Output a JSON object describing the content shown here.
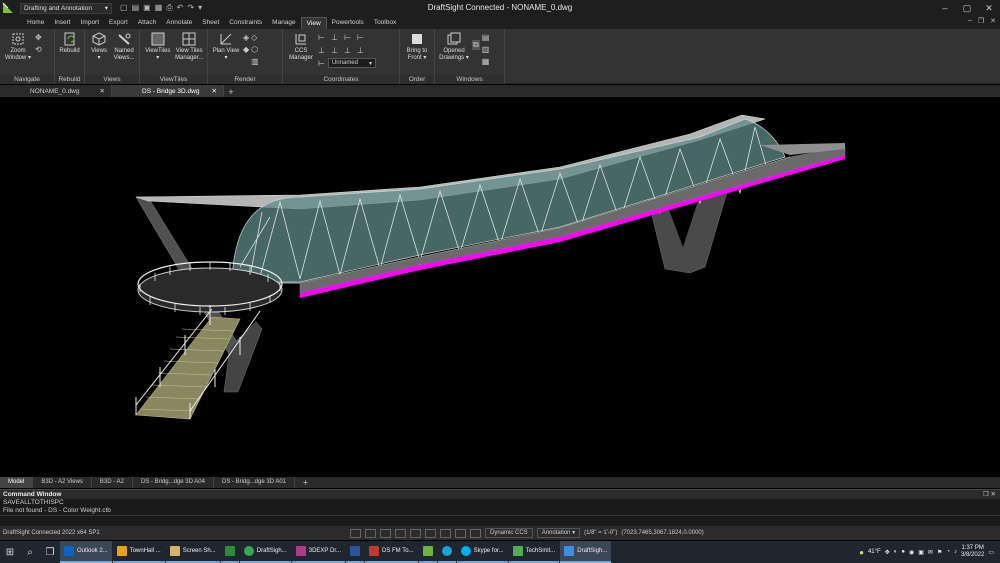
{
  "titlebar": {
    "workspace": "Drafting and Annotation",
    "title": "DraftSight Connected - NONAME_0.dwg"
  },
  "ribbon_tabs": [
    "Home",
    "Insert",
    "Import",
    "Export",
    "Attach",
    "Annotate",
    "Sheet",
    "Constraints",
    "Manage",
    "View",
    "Powertools",
    "Toolbox"
  ],
  "active_tab": "View",
  "ribbon": {
    "navigate": {
      "label": "Navigate",
      "zoom": "Zoom\nWindow ▾"
    },
    "rebuild": {
      "label": "Rebuild",
      "rebuild": "Rebuild"
    },
    "views": {
      "label": "Views",
      "views": "Views\n▾",
      "named": "Named\nViews..."
    },
    "viewtiles": {
      "label": "ViewTiles",
      "viewtiles": "ViewTiles\n▾",
      "manager": "View Tiles\nManager..."
    },
    "render": {
      "label": "Render",
      "plan": "Plan View\n▾"
    },
    "coordinates": {
      "label": "Coordinates",
      "ccs": "CCS\nManager",
      "combo": "Unnamed"
    },
    "order": {
      "label": "Order",
      "bring": "Bring to\nFront ▾"
    },
    "windows": {
      "label": "Windows",
      "opened": "Opened\nDrawings ▾"
    }
  },
  "doc_tabs": [
    {
      "label": "NONAME_0.dwg",
      "active": false
    },
    {
      "label": "DS - Bridge 3D.dwg",
      "active": true
    }
  ],
  "layout_tabs": [
    "Model",
    "B3D - A2 Views",
    "B3D - A2",
    "DS - Bridg...dge 3D A04",
    "DS - Bridg...dge 3D A01"
  ],
  "command": {
    "title": "Command Window",
    "lines": [
      "SAVEALLTOTHISPC",
      "File not found - DS - Color Weight.ctb"
    ]
  },
  "status": {
    "app": "DraftSight Connected 2022  x64 SP1",
    "dynamic": "Dynamic CCS",
    "annotation": "Annotation",
    "scale": "(1/8\" = 1'-0\")",
    "coords": "(7023.7465,3067.1824,0.0000)"
  },
  "taskbar": {
    "apps": [
      {
        "label": "Outlook 2...",
        "color": "#0a64c8"
      },
      {
        "label": "TownHall ...",
        "color": "#e8a317"
      },
      {
        "label": "Screen Sh...",
        "color": "#d8b26a"
      },
      {
        "label": "",
        "color": "#2d8a3a"
      },
      {
        "label": "DraftSigh...",
        "color": "#35a853"
      },
      {
        "label": "3DEXP Dr...",
        "color": "#b03a8c"
      },
      {
        "label": "",
        "color": "#2b579a"
      },
      {
        "label": "DS FM To...",
        "color": "#c0392b"
      },
      {
        "label": "",
        "color": "#6fb33f"
      },
      {
        "label": "",
        "color": "#1aa3d9"
      },
      {
        "label": "Skype for...",
        "color": "#00aff0"
      },
      {
        "label": "TechSmit...",
        "color": "#4caf50"
      },
      {
        "label": "DraftSigh...",
        "color": "#3a8ee6"
      }
    ],
    "weather": "41°F",
    "time": "1:37 PM",
    "date": "3/8/2022"
  }
}
